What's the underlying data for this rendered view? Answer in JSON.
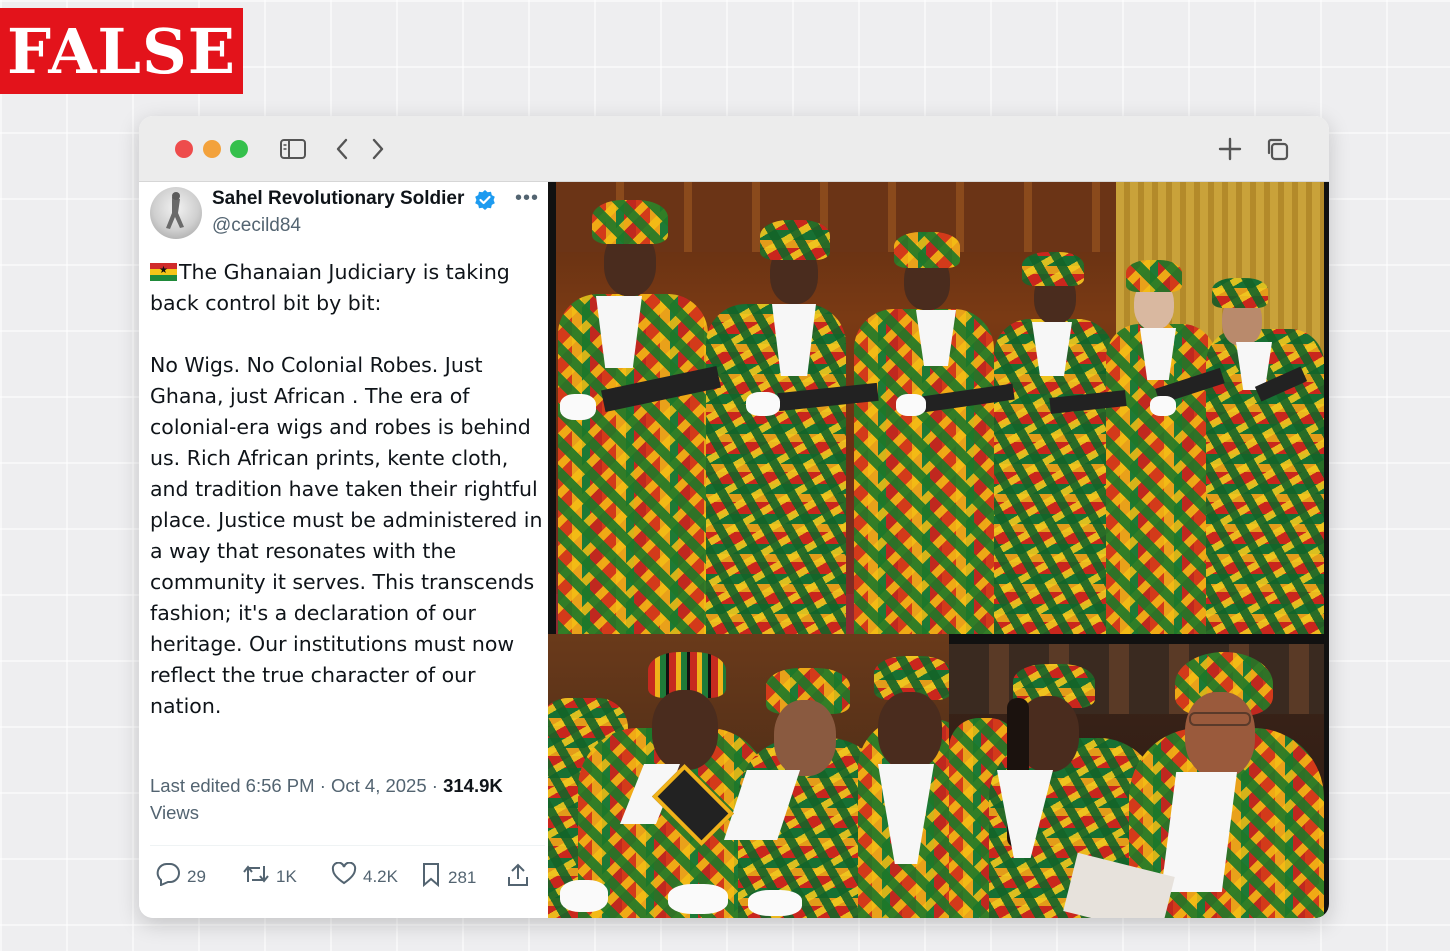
{
  "badge": {
    "label": "FALSE",
    "color": "#e3131b"
  },
  "browser": {
    "icons": {
      "sidebar": "sidebar-icon",
      "back": "chevron-left-icon",
      "forward": "chevron-right-icon",
      "new_tab": "plus-icon",
      "tabs": "tab-overview-icon"
    }
  },
  "tweet": {
    "author": {
      "name": "Sahel Revolutionary Soldier",
      "handle": "@cecild84",
      "verified": true
    },
    "text": {
      "line1": "The Ghanaian Judiciary is taking back  control bit by bit:",
      "line2": "No Wigs. No Colonial Robes. Just Ghana, just African . The era of colonial-era wigs and robes is behind us. Rich African prints, kente cloth, and tradition have taken their rightful place. Justice must be administered in a way that resonates with the community it serves. This transcends fashion; it's a declaration of our heritage. Our institutions must now reflect the true character of our nation."
    },
    "meta": {
      "edited": "Last edited 6:56 PM · Oct 4, 2025 · ",
      "views_count": "314.9K",
      "views_label": "Views"
    },
    "actions": {
      "replies": "29",
      "reposts": "1K",
      "likes": "4.2K",
      "bookmarks": "281"
    }
  },
  "colors": {
    "text_primary": "#0f1419",
    "text_secondary": "#536471",
    "verified_blue": "#1d9bf0",
    "traffic_red": "#ee4c4c",
    "traffic_yellow": "#f3a23c",
    "traffic_green": "#35c04c"
  }
}
